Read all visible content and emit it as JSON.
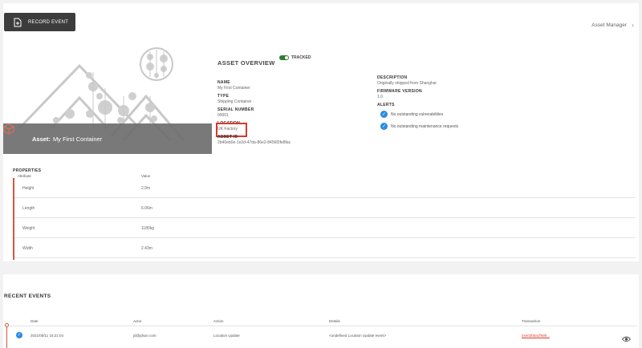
{
  "toolbar": {
    "record_label": "RECORD EVENT"
  },
  "nav": {
    "asset_manager": "Asset Manager"
  },
  "hero": {
    "asset_prefix": "Asset:",
    "asset_name": "My First Container"
  },
  "overview": {
    "title": "ASSET OVERVIEW",
    "tracked_label": "TRACKED",
    "name_label": "NAME",
    "name_value": "My First Container",
    "type_label": "TYPE",
    "type_value": "Shipping Container",
    "serial_label": "SERIAL NUMBER",
    "serial_value": "00001",
    "location_label": "LOCATION",
    "location_value": "UK Factory",
    "assetid_label": "ASSET ID",
    "assetid_value": "2b40eb0e-1e2d-47da-86e2-8456f2fe8fac",
    "description_label": "DESCRIPTION",
    "description_value": "Originally shipped from Shanghai",
    "firmware_label": "FIRMWARE VERSION",
    "firmware_value": "1.0",
    "alerts_label": "ALERTS",
    "alerts": [
      "No outstanding vulnerabilities",
      "No outstanding maintenance requests"
    ]
  },
  "properties": {
    "title": "PROPERTIES",
    "col_attribute": "Attribute",
    "col_value": "Value",
    "rows": [
      {
        "attribute": "Height",
        "value": "2.9m"
      },
      {
        "attribute": "Length",
        "value": "6.06m"
      },
      {
        "attribute": "Weight",
        "value": "1180kg"
      },
      {
        "attribute": "Width",
        "value": "2.43m"
      }
    ]
  },
  "recent_events": {
    "title": "RECENT EVENTS",
    "columns": {
      "date": "Date",
      "actor": "Actor",
      "action": "Action",
      "details": "Details",
      "transaction": "Transaction"
    },
    "rows": [
      {
        "date": "2021/05/11 15:21:04",
        "actor": "jd@jdsun.com",
        "action": "Location Update",
        "details": "<undefined Location Update event>",
        "transaction": "0xe02bba1f9d9..."
      }
    ]
  },
  "colors": {
    "accent": "#d93a2b",
    "rail": "#d5573b",
    "check": "#2a8be6",
    "toggle": "#2e7d32"
  }
}
